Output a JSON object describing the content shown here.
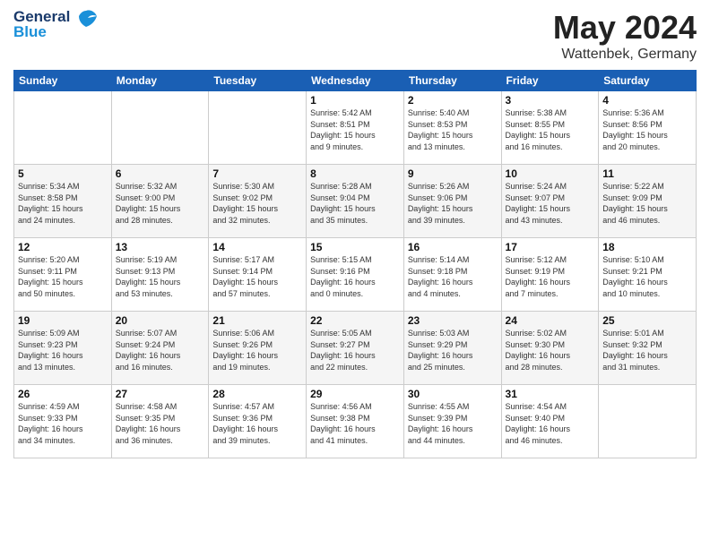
{
  "logo": {
    "line1": "General",
    "line2": "Blue"
  },
  "title": "May 2024",
  "location": "Wattenbek, Germany",
  "days_of_week": [
    "Sunday",
    "Monday",
    "Tuesday",
    "Wednesday",
    "Thursday",
    "Friday",
    "Saturday"
  ],
  "weeks": [
    [
      {
        "day": "",
        "info": ""
      },
      {
        "day": "",
        "info": ""
      },
      {
        "day": "",
        "info": ""
      },
      {
        "day": "1",
        "info": "Sunrise: 5:42 AM\nSunset: 8:51 PM\nDaylight: 15 hours\nand 9 minutes."
      },
      {
        "day": "2",
        "info": "Sunrise: 5:40 AM\nSunset: 8:53 PM\nDaylight: 15 hours\nand 13 minutes."
      },
      {
        "day": "3",
        "info": "Sunrise: 5:38 AM\nSunset: 8:55 PM\nDaylight: 15 hours\nand 16 minutes."
      },
      {
        "day": "4",
        "info": "Sunrise: 5:36 AM\nSunset: 8:56 PM\nDaylight: 15 hours\nand 20 minutes."
      }
    ],
    [
      {
        "day": "5",
        "info": "Sunrise: 5:34 AM\nSunset: 8:58 PM\nDaylight: 15 hours\nand 24 minutes."
      },
      {
        "day": "6",
        "info": "Sunrise: 5:32 AM\nSunset: 9:00 PM\nDaylight: 15 hours\nand 28 minutes."
      },
      {
        "day": "7",
        "info": "Sunrise: 5:30 AM\nSunset: 9:02 PM\nDaylight: 15 hours\nand 32 minutes."
      },
      {
        "day": "8",
        "info": "Sunrise: 5:28 AM\nSunset: 9:04 PM\nDaylight: 15 hours\nand 35 minutes."
      },
      {
        "day": "9",
        "info": "Sunrise: 5:26 AM\nSunset: 9:06 PM\nDaylight: 15 hours\nand 39 minutes."
      },
      {
        "day": "10",
        "info": "Sunrise: 5:24 AM\nSunset: 9:07 PM\nDaylight: 15 hours\nand 43 minutes."
      },
      {
        "day": "11",
        "info": "Sunrise: 5:22 AM\nSunset: 9:09 PM\nDaylight: 15 hours\nand 46 minutes."
      }
    ],
    [
      {
        "day": "12",
        "info": "Sunrise: 5:20 AM\nSunset: 9:11 PM\nDaylight: 15 hours\nand 50 minutes."
      },
      {
        "day": "13",
        "info": "Sunrise: 5:19 AM\nSunset: 9:13 PM\nDaylight: 15 hours\nand 53 minutes."
      },
      {
        "day": "14",
        "info": "Sunrise: 5:17 AM\nSunset: 9:14 PM\nDaylight: 15 hours\nand 57 minutes."
      },
      {
        "day": "15",
        "info": "Sunrise: 5:15 AM\nSunset: 9:16 PM\nDaylight: 16 hours\nand 0 minutes."
      },
      {
        "day": "16",
        "info": "Sunrise: 5:14 AM\nSunset: 9:18 PM\nDaylight: 16 hours\nand 4 minutes."
      },
      {
        "day": "17",
        "info": "Sunrise: 5:12 AM\nSunset: 9:19 PM\nDaylight: 16 hours\nand 7 minutes."
      },
      {
        "day": "18",
        "info": "Sunrise: 5:10 AM\nSunset: 9:21 PM\nDaylight: 16 hours\nand 10 minutes."
      }
    ],
    [
      {
        "day": "19",
        "info": "Sunrise: 5:09 AM\nSunset: 9:23 PM\nDaylight: 16 hours\nand 13 minutes."
      },
      {
        "day": "20",
        "info": "Sunrise: 5:07 AM\nSunset: 9:24 PM\nDaylight: 16 hours\nand 16 minutes."
      },
      {
        "day": "21",
        "info": "Sunrise: 5:06 AM\nSunset: 9:26 PM\nDaylight: 16 hours\nand 19 minutes."
      },
      {
        "day": "22",
        "info": "Sunrise: 5:05 AM\nSunset: 9:27 PM\nDaylight: 16 hours\nand 22 minutes."
      },
      {
        "day": "23",
        "info": "Sunrise: 5:03 AM\nSunset: 9:29 PM\nDaylight: 16 hours\nand 25 minutes."
      },
      {
        "day": "24",
        "info": "Sunrise: 5:02 AM\nSunset: 9:30 PM\nDaylight: 16 hours\nand 28 minutes."
      },
      {
        "day": "25",
        "info": "Sunrise: 5:01 AM\nSunset: 9:32 PM\nDaylight: 16 hours\nand 31 minutes."
      }
    ],
    [
      {
        "day": "26",
        "info": "Sunrise: 4:59 AM\nSunset: 9:33 PM\nDaylight: 16 hours\nand 34 minutes."
      },
      {
        "day": "27",
        "info": "Sunrise: 4:58 AM\nSunset: 9:35 PM\nDaylight: 16 hours\nand 36 minutes."
      },
      {
        "day": "28",
        "info": "Sunrise: 4:57 AM\nSunset: 9:36 PM\nDaylight: 16 hours\nand 39 minutes."
      },
      {
        "day": "29",
        "info": "Sunrise: 4:56 AM\nSunset: 9:38 PM\nDaylight: 16 hours\nand 41 minutes."
      },
      {
        "day": "30",
        "info": "Sunrise: 4:55 AM\nSunset: 9:39 PM\nDaylight: 16 hours\nand 44 minutes."
      },
      {
        "day": "31",
        "info": "Sunrise: 4:54 AM\nSunset: 9:40 PM\nDaylight: 16 hours\nand 46 minutes."
      },
      {
        "day": "",
        "info": ""
      }
    ]
  ]
}
